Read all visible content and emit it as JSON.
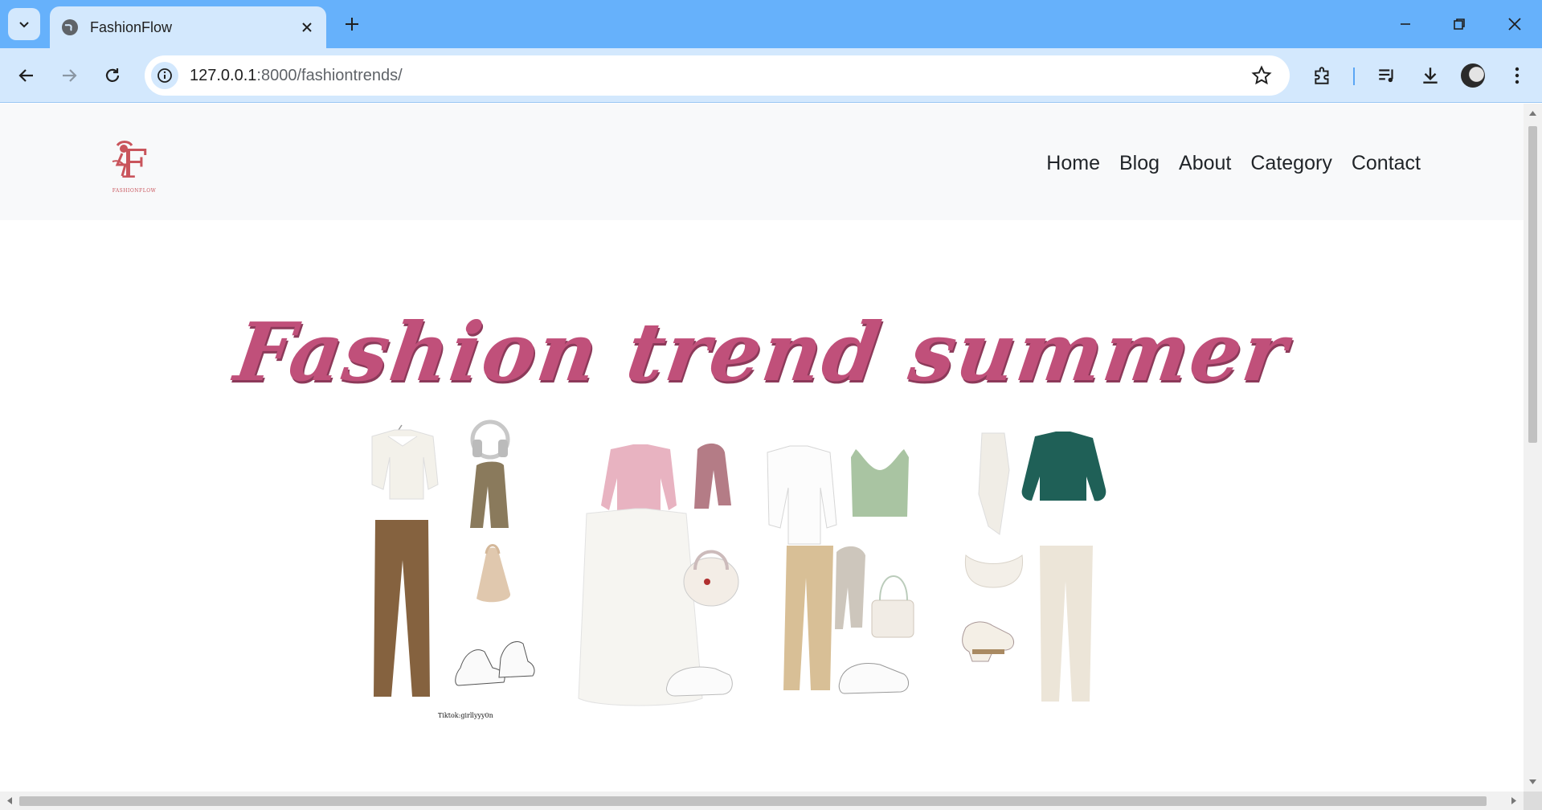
{
  "browser": {
    "tab_title": "FashionFlow",
    "url_host": "127.0.0.1",
    "url_path": ":8000/fashiontrends/"
  },
  "site": {
    "logo_text": "FASHIONFLOW",
    "nav": [
      "Home",
      "Blog",
      "About",
      "Category",
      "Contact"
    ],
    "hero_title": "Fashion trend summer",
    "collage_credit": "Tiktok:girllyyy0n"
  },
  "colors": {
    "tabbar": "#66b1fb",
    "toolbar": "#d3e8fd",
    "title_pink": "#c0507a",
    "logo_red": "#c9555c"
  }
}
